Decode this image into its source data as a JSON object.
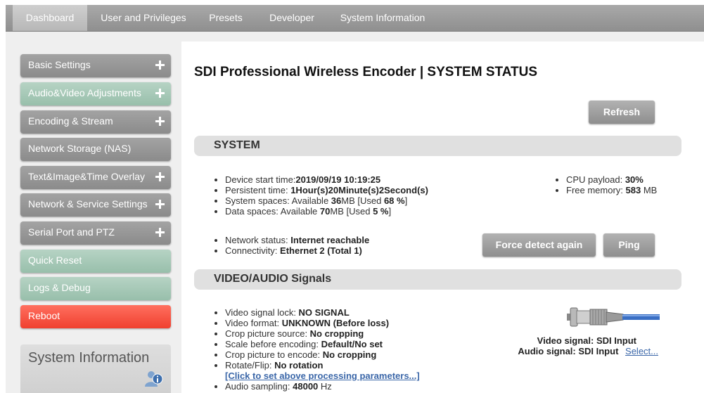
{
  "nav": {
    "tabs": [
      {
        "label": "Dashboard",
        "active": true
      },
      {
        "label": "User and Privileges"
      },
      {
        "label": "Presets"
      },
      {
        "label": "Developer"
      },
      {
        "label": "System Information"
      }
    ]
  },
  "sidebar": {
    "items": [
      {
        "label": "Basic Settings",
        "style": "gray",
        "expandable": true
      },
      {
        "label": "Audio&Video Adjustments",
        "style": "green",
        "expandable": true
      },
      {
        "label": "Encoding & Stream",
        "style": "gray",
        "expandable": true
      },
      {
        "label": "Network Storage (NAS)",
        "style": "gray",
        "expandable": false
      },
      {
        "label": "Text&Image&Time Overlay",
        "style": "gray",
        "expandable": true
      },
      {
        "label": "Network & Service Settings",
        "style": "gray",
        "expandable": true
      },
      {
        "label": "Serial Port and PTZ",
        "style": "gray",
        "expandable": true
      },
      {
        "label": "Quick Reset",
        "style": "green",
        "expandable": false
      },
      {
        "label": "Logs & Debug",
        "style": "green",
        "expandable": false
      },
      {
        "label": "Reboot",
        "style": "red",
        "expandable": false
      }
    ],
    "system_info_title": "System Information"
  },
  "main": {
    "title": "SDI Professional Wireless Encoder | SYSTEM STATUS",
    "refresh_label": "Refresh",
    "system": {
      "heading": "SYSTEM",
      "device_start_label": "Device start time:",
      "device_start_value": "2019/09/19 10:19:25",
      "persistent_label": "Persistent time: ",
      "persistent_value": "1Hour(s)20Minute(s)2Second(s)",
      "system_spaces_label": "System spaces: Available ",
      "system_spaces_avail": "36",
      "system_spaces_mid": "MB [Used ",
      "system_spaces_used": "68 %",
      "system_spaces_end": "]",
      "data_spaces_label": "Data spaces: Available ",
      "data_spaces_avail": "70",
      "data_spaces_mid": "MB [Used ",
      "data_spaces_used": "5 %",
      "data_spaces_end": "]",
      "cpu_label": "CPU payload: ",
      "cpu_value": "30%",
      "mem_label": "Free memory: ",
      "mem_value": "583",
      "mem_unit": " MB",
      "network_label": "Network status: ",
      "network_value": "Internet reachable",
      "connectivity_label": "Connectivity: ",
      "connectivity_value": "Ethernet 2 (Total 1)",
      "force_detect_label": "Force detect again",
      "ping_label": "Ping"
    },
    "signals": {
      "heading": "VIDEO/AUDIO Signals",
      "video_lock_label": "Video signal lock: ",
      "video_lock_value": "NO SIGNAL",
      "video_format_label": "Video format: ",
      "video_format_value": "UNKNOWN (Before loss)",
      "crop_source_label": "Crop picture source: ",
      "crop_source_value": "No cropping",
      "scale_label": "Scale before encoding: ",
      "scale_value": "Default/No set",
      "crop_encode_label": "Crop picture to encode: ",
      "crop_encode_value": "No cropping",
      "rotate_label": "Rotate/Flip: ",
      "rotate_value": "No rotation",
      "processing_link": "[Click to set above processing parameters...]",
      "audio_sampling_label": "Audio sampling: ",
      "audio_sampling_value": "48000",
      "audio_sampling_unit": " Hz",
      "video_signal_text": "Video signal: SDI Input",
      "audio_signal_text": "Audio signal: SDI Input",
      "select_link": "Select..."
    }
  }
}
